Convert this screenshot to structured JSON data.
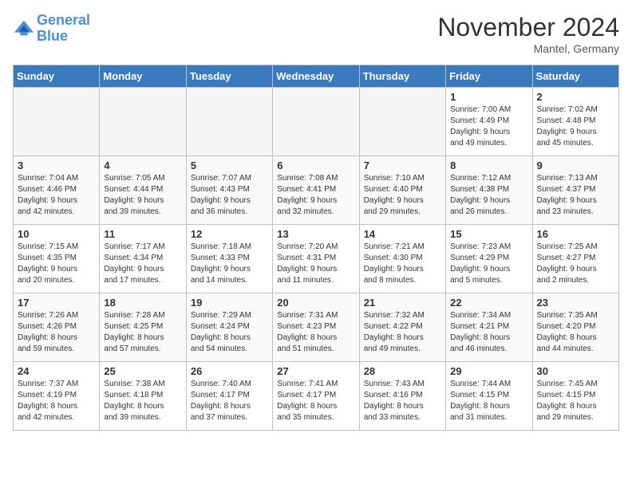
{
  "header": {
    "logo_line1": "General",
    "logo_line2": "Blue",
    "month": "November 2024",
    "location": "Mantel, Germany"
  },
  "weekdays": [
    "Sunday",
    "Monday",
    "Tuesday",
    "Wednesday",
    "Thursday",
    "Friday",
    "Saturday"
  ],
  "weeks": [
    [
      {
        "day": "",
        "info": ""
      },
      {
        "day": "",
        "info": ""
      },
      {
        "day": "",
        "info": ""
      },
      {
        "day": "",
        "info": ""
      },
      {
        "day": "",
        "info": ""
      },
      {
        "day": "1",
        "info": "Sunrise: 7:00 AM\nSunset: 4:49 PM\nDaylight: 9 hours\nand 49 minutes."
      },
      {
        "day": "2",
        "info": "Sunrise: 7:02 AM\nSunset: 4:48 PM\nDaylight: 9 hours\nand 45 minutes."
      }
    ],
    [
      {
        "day": "3",
        "info": "Sunrise: 7:04 AM\nSunset: 4:46 PM\nDaylight: 9 hours\nand 42 minutes."
      },
      {
        "day": "4",
        "info": "Sunrise: 7:05 AM\nSunset: 4:44 PM\nDaylight: 9 hours\nand 39 minutes."
      },
      {
        "day": "5",
        "info": "Sunrise: 7:07 AM\nSunset: 4:43 PM\nDaylight: 9 hours\nand 36 minutes."
      },
      {
        "day": "6",
        "info": "Sunrise: 7:08 AM\nSunset: 4:41 PM\nDaylight: 9 hours\nand 32 minutes."
      },
      {
        "day": "7",
        "info": "Sunrise: 7:10 AM\nSunset: 4:40 PM\nDaylight: 9 hours\nand 29 minutes."
      },
      {
        "day": "8",
        "info": "Sunrise: 7:12 AM\nSunset: 4:38 PM\nDaylight: 9 hours\nand 26 minutes."
      },
      {
        "day": "9",
        "info": "Sunrise: 7:13 AM\nSunset: 4:37 PM\nDaylight: 9 hours\nand 23 minutes."
      }
    ],
    [
      {
        "day": "10",
        "info": "Sunrise: 7:15 AM\nSunset: 4:35 PM\nDaylight: 9 hours\nand 20 minutes."
      },
      {
        "day": "11",
        "info": "Sunrise: 7:17 AM\nSunset: 4:34 PM\nDaylight: 9 hours\nand 17 minutes."
      },
      {
        "day": "12",
        "info": "Sunrise: 7:18 AM\nSunset: 4:33 PM\nDaylight: 9 hours\nand 14 minutes."
      },
      {
        "day": "13",
        "info": "Sunrise: 7:20 AM\nSunset: 4:31 PM\nDaylight: 9 hours\nand 11 minutes."
      },
      {
        "day": "14",
        "info": "Sunrise: 7:21 AM\nSunset: 4:30 PM\nDaylight: 9 hours\nand 8 minutes."
      },
      {
        "day": "15",
        "info": "Sunrise: 7:23 AM\nSunset: 4:29 PM\nDaylight: 9 hours\nand 5 minutes."
      },
      {
        "day": "16",
        "info": "Sunrise: 7:25 AM\nSunset: 4:27 PM\nDaylight: 9 hours\nand 2 minutes."
      }
    ],
    [
      {
        "day": "17",
        "info": "Sunrise: 7:26 AM\nSunset: 4:26 PM\nDaylight: 8 hours\nand 59 minutes."
      },
      {
        "day": "18",
        "info": "Sunrise: 7:28 AM\nSunset: 4:25 PM\nDaylight: 8 hours\nand 57 minutes."
      },
      {
        "day": "19",
        "info": "Sunrise: 7:29 AM\nSunset: 4:24 PM\nDaylight: 8 hours\nand 54 minutes."
      },
      {
        "day": "20",
        "info": "Sunrise: 7:31 AM\nSunset: 4:23 PM\nDaylight: 8 hours\nand 51 minutes."
      },
      {
        "day": "21",
        "info": "Sunrise: 7:32 AM\nSunset: 4:22 PM\nDaylight: 8 hours\nand 49 minutes."
      },
      {
        "day": "22",
        "info": "Sunrise: 7:34 AM\nSunset: 4:21 PM\nDaylight: 8 hours\nand 46 minutes."
      },
      {
        "day": "23",
        "info": "Sunrise: 7:35 AM\nSunset: 4:20 PM\nDaylight: 8 hours\nand 44 minutes."
      }
    ],
    [
      {
        "day": "24",
        "info": "Sunrise: 7:37 AM\nSunset: 4:19 PM\nDaylight: 8 hours\nand 42 minutes."
      },
      {
        "day": "25",
        "info": "Sunrise: 7:38 AM\nSunset: 4:18 PM\nDaylight: 8 hours\nand 39 minutes."
      },
      {
        "day": "26",
        "info": "Sunrise: 7:40 AM\nSunset: 4:17 PM\nDaylight: 8 hours\nand 37 minutes."
      },
      {
        "day": "27",
        "info": "Sunrise: 7:41 AM\nSunset: 4:17 PM\nDaylight: 8 hours\nand 35 minutes."
      },
      {
        "day": "28",
        "info": "Sunrise: 7:43 AM\nSunset: 4:16 PM\nDaylight: 8 hours\nand 33 minutes."
      },
      {
        "day": "29",
        "info": "Sunrise: 7:44 AM\nSunset: 4:15 PM\nDaylight: 8 hours\nand 31 minutes."
      },
      {
        "day": "30",
        "info": "Sunrise: 7:45 AM\nSunset: 4:15 PM\nDaylight: 8 hours\nand 29 minutes."
      }
    ]
  ]
}
